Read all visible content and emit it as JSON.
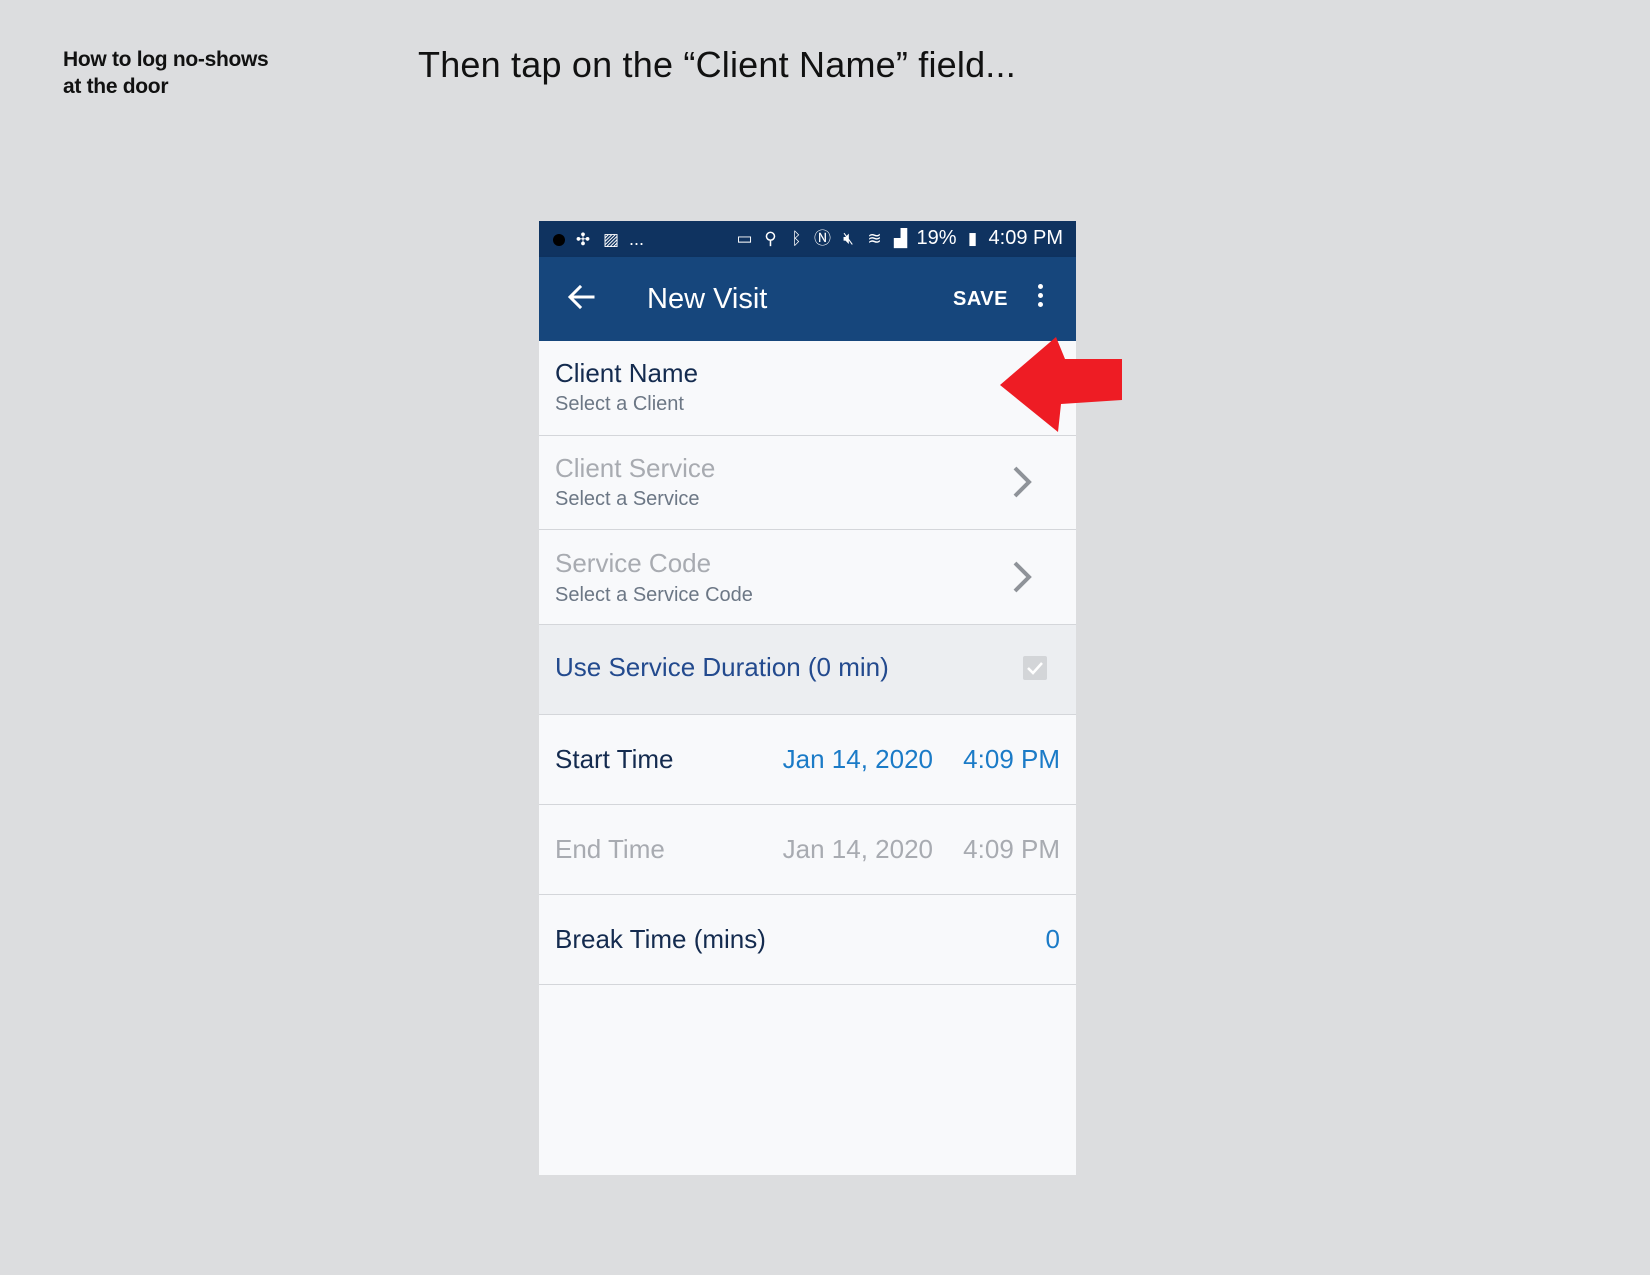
{
  "doc": {
    "title_line1": "How to log no-shows",
    "title_line2": "at the door",
    "instruction": "Then tap on the “Client Name” field..."
  },
  "status_bar": {
    "left_ellipsis": "...",
    "battery": "19%",
    "time": "4:09 PM"
  },
  "app_bar": {
    "title": "New Visit",
    "save_label": "SAVE"
  },
  "form": {
    "client_name": {
      "label": "Client Name",
      "placeholder": "Select a Client"
    },
    "client_service": {
      "label": "Client Service",
      "placeholder": "Select a Service"
    },
    "service_code": {
      "label": "Service Code",
      "placeholder": "Select a Service Code"
    },
    "use_service_duration": {
      "label": "Use Service Duration (0 min)",
      "checked": true
    },
    "start_time": {
      "label": "Start Time",
      "date": "Jan 14, 2020",
      "time": "4:09 PM"
    },
    "end_time": {
      "label": "End Time",
      "date": "Jan 14, 2020",
      "time": "4:09 PM"
    },
    "break_time": {
      "label": "Break Time (mins)",
      "value": "0"
    }
  },
  "colors": {
    "page_background": "#dcdddf",
    "status_bar": "#0f3360",
    "app_bar": "#16467c",
    "title_text": "#142b4f",
    "disabled_text": "#a8abb1",
    "link_blue": "#1b7bc7",
    "toggle_label": "#234a8e",
    "annotation_arrow": "#ee1c24"
  }
}
